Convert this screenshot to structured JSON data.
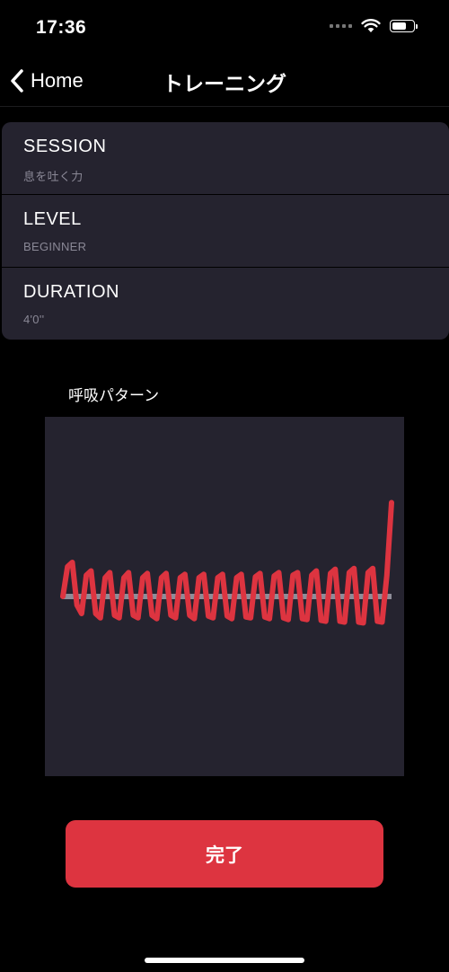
{
  "status_bar": {
    "time": "17:36"
  },
  "nav": {
    "back_label": "Home",
    "title": "トレーニング"
  },
  "info": [
    {
      "title": "SESSION",
      "value": "息を吐く力"
    },
    {
      "title": "LEVEL",
      "value": "BEGINNER"
    },
    {
      "title": "DURATION",
      "value": "4'0''"
    }
  ],
  "chart": {
    "title": "呼吸パターン",
    "line_color": "#dd3440",
    "baseline_color": "#8e8d99",
    "background": "#25232f"
  },
  "chart_data": {
    "type": "line",
    "series": [
      {
        "values": [
          0,
          0.35,
          0.4,
          -0.1,
          -0.2,
          0.25,
          0.3,
          -0.2,
          -0.25,
          0.22,
          0.28,
          -0.22,
          -0.25,
          0.22,
          0.28,
          -0.22,
          -0.25,
          0.22,
          0.27,
          -0.22,
          -0.26,
          0.22,
          0.27,
          -0.22,
          -0.25,
          0.22,
          0.26,
          -0.22,
          -0.26,
          0.22,
          0.26,
          -0.23,
          -0.25,
          0.22,
          0.26,
          -0.23,
          -0.26,
          0.22,
          0.26,
          -0.24,
          -0.25,
          0.23,
          0.27,
          -0.24,
          -0.26,
          0.24,
          0.28,
          -0.25,
          -0.27,
          0.25,
          0.28,
          -0.26,
          -0.27,
          0.25,
          0.3,
          -0.28,
          -0.29,
          0.27,
          0.32,
          -0.29,
          -0.3,
          0.28,
          0.33,
          -0.3,
          -0.31,
          0.28,
          0.33,
          -0.29,
          -0.3,
          0.25,
          1.1
        ]
      }
    ],
    "baseline": 0
  },
  "actions": {
    "done_label": "完了"
  }
}
